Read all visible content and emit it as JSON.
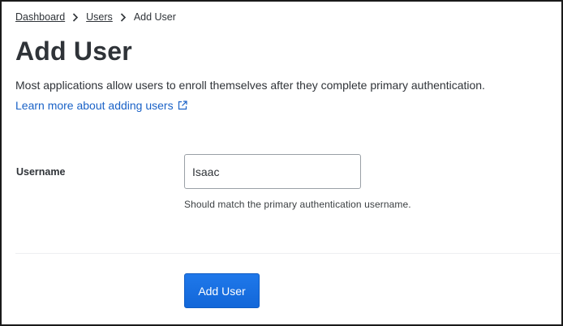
{
  "breadcrumb": {
    "items": [
      "Dashboard",
      "Users"
    ],
    "current": "Add User"
  },
  "page": {
    "title": "Add User",
    "description": "Most applications allow users to enroll themselves after they complete primary authentication.",
    "learn_more": "Learn more about adding users"
  },
  "form": {
    "username_label": "Username",
    "username_value": "Isaac",
    "username_hint": "Should match the primary authentication username.",
    "submit_label": "Add User"
  },
  "icons": {
    "breadcrumb_separator": "chevron-right-icon",
    "external_link": "external-link-icon"
  },
  "colors": {
    "link": "#1a62c7",
    "primary_button": "#1a73e8",
    "text": "#2f3338"
  }
}
